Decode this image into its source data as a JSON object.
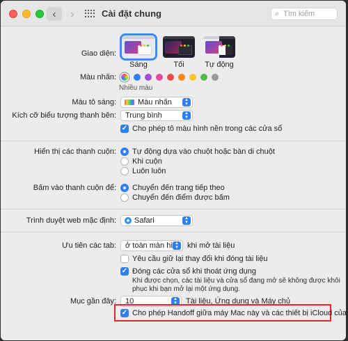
{
  "window": {
    "title": "Cài đặt chung",
    "search_placeholder": "Tìm kiếm"
  },
  "appearance": {
    "label": "Giao diện:",
    "options": [
      {
        "label": "Sáng",
        "selected": true
      },
      {
        "label": "Tối",
        "selected": false
      },
      {
        "label": "Tự động",
        "selected": false
      }
    ]
  },
  "accent": {
    "label": "Màu nhấn:",
    "selected_caption": "Nhiều màu",
    "colors": [
      "#multicolor",
      "#2f7ff2",
      "#9b4fd3",
      "#e54aa0",
      "#e94b4b",
      "#f38a1d",
      "#f7c62f",
      "#56b84a",
      "#9a9a9a"
    ]
  },
  "highlight_color": {
    "label": "Màu tô sáng:",
    "value": "Màu nhấn"
  },
  "sidebar_icon_size": {
    "label": "Kích cỡ biểu tượng thanh bên:",
    "value": "Trung bình"
  },
  "wallpaper_tinting": {
    "label": "Cho phép tô màu hình nền trong các cửa sổ",
    "checked": true
  },
  "scroll_bars": {
    "label": "Hiển thị các thanh cuộn:",
    "options": [
      {
        "label": "Tự động dựa vào chuột hoặc bàn di chuột",
        "selected": true
      },
      {
        "label": "Khi cuộn",
        "selected": false
      },
      {
        "label": "Luôn luôn",
        "selected": false
      }
    ]
  },
  "click_scroll": {
    "label": "Bấm vào thanh cuộn để:",
    "options": [
      {
        "label": "Chuyển đến trang tiếp theo",
        "selected": true
      },
      {
        "label": "Chuyển đến điểm được bấm",
        "selected": false
      }
    ]
  },
  "default_browser": {
    "label": "Trình duyệt web mặc định:",
    "value": "Safari"
  },
  "prefer_tabs": {
    "label": "Ưu tiên các tab:",
    "value": "ở toàn màn hình",
    "suffix": "khi mở tài liệu"
  },
  "ask_keep_changes": {
    "label": "Yêu cầu giữ lại thay đổi khi đóng tài liệu",
    "checked": false
  },
  "close_windows": {
    "label": "Đóng các cửa sổ khi thoát ứng dụng",
    "checked": true,
    "note_line1": "Khi được chọn, các tài liệu và cửa sổ đang mở sẽ không được khôi",
    "note_line2": "phục khi bạn mở lại một ứng dụng."
  },
  "recent_items": {
    "label": "Mục gần đây:",
    "value": "10",
    "suffix": "Tài liệu, Ứng dụng và Máy chủ"
  },
  "handoff": {
    "label": "Cho phép Handoff giữa máy Mac này và các thiết bị iCloud của bạn",
    "checked": true
  },
  "colors": {
    "accent": "#2f7ff2",
    "highlight_box": "#e3262e"
  }
}
